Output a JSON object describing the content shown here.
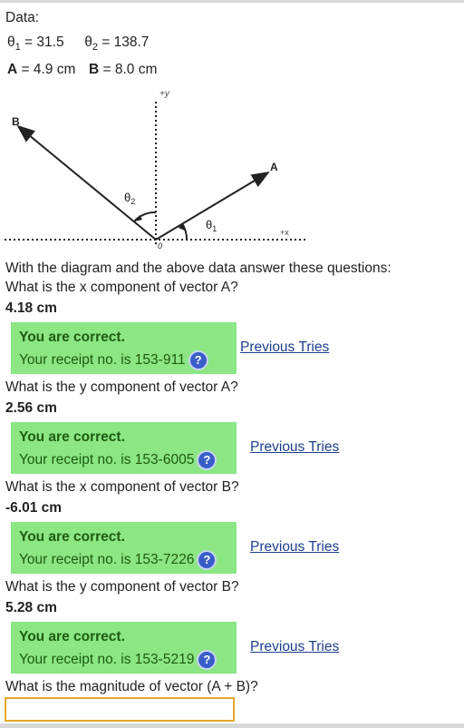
{
  "data_section": {
    "label": "Data:",
    "theta1_symbol": "θ",
    "theta1_sub": "1",
    "theta1_value": " = 31.5",
    "theta2_symbol": "θ",
    "theta2_sub": "2",
    "theta2_value": " = 138.7",
    "a_label": "A",
    "a_value": " = 4.9 cm",
    "b_label": "B",
    "b_value": " = 8.0 cm"
  },
  "diagram": {
    "plus_y": "+y",
    "plus_x": "+x",
    "vector_a": "A",
    "vector_b": "B",
    "origin": "0",
    "theta1_label": "θ",
    "theta1_sub": "1",
    "theta2_label": "θ",
    "theta2_sub": "2"
  },
  "intro": "With the diagram and the above data answer these questions:",
  "questions": [
    {
      "question": "What is the x component of vector A?",
      "answer": "4.18 cm",
      "feedback_title": "You are correct.",
      "receipt": "Your receipt no. is 153-911",
      "link": "Previous Tries"
    },
    {
      "question": "What is the y component of vector A?",
      "answer": "2.56 cm",
      "feedback_title": "You are correct.",
      "receipt": "Your receipt no. is 153-6005",
      "link": "Previous Tries"
    },
    {
      "question": "What is the x component of vector B?",
      "answer": "-6.01 cm",
      "feedback_title": "You are correct.",
      "receipt": "Your receipt no. is 153-7226",
      "link": "Previous Tries"
    },
    {
      "question": "What is the y component of vector B?",
      "answer": "5.28 cm",
      "feedback_title": "You are correct.",
      "receipt": "Your receipt no. is 153-5219",
      "link": "Previous Tries"
    }
  ],
  "final_question": "What is the magnitude of vector (A + B)?",
  "final_input": {
    "value": "",
    "placeholder": ""
  },
  "help_glyph": "?",
  "colors": {
    "feedback_bg": "#8be683",
    "feedback_text": "#1d5c12",
    "link": "#1a3e8c",
    "input_border": "#e3a92b",
    "help_icon": "#3a5ec9"
  }
}
